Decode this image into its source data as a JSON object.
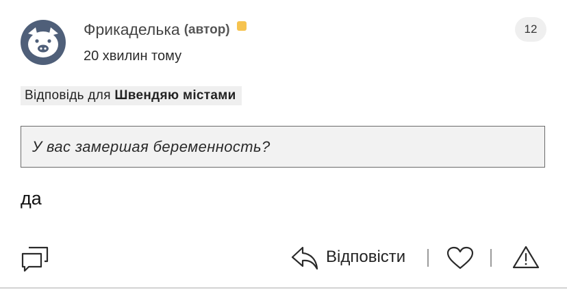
{
  "comment": {
    "author": {
      "name": "Фрикаделька",
      "tag": "(автор)",
      "status_color": "#f6c34f",
      "avatar_icon": "pig-avatar-icon"
    },
    "timestamp": "20 хвилин тому",
    "count_badge": "12",
    "reply_to": {
      "prefix": "Відповідь для",
      "target": "Швендяю містами"
    },
    "quote": "У вас замершая беременность?",
    "body": "да"
  },
  "actions": {
    "chat_icon": "comments-icon",
    "reply_label": "Відповісти",
    "reply_icon": "reply-arrow-icon",
    "like_icon": "heart-icon",
    "report_icon": "warning-triangle-icon"
  },
  "colors": {
    "accent_dot": "#f6c34f",
    "avatar": "#4f5f79",
    "badge_bg": "#efefef",
    "quote_bg": "#f2f2f2"
  }
}
